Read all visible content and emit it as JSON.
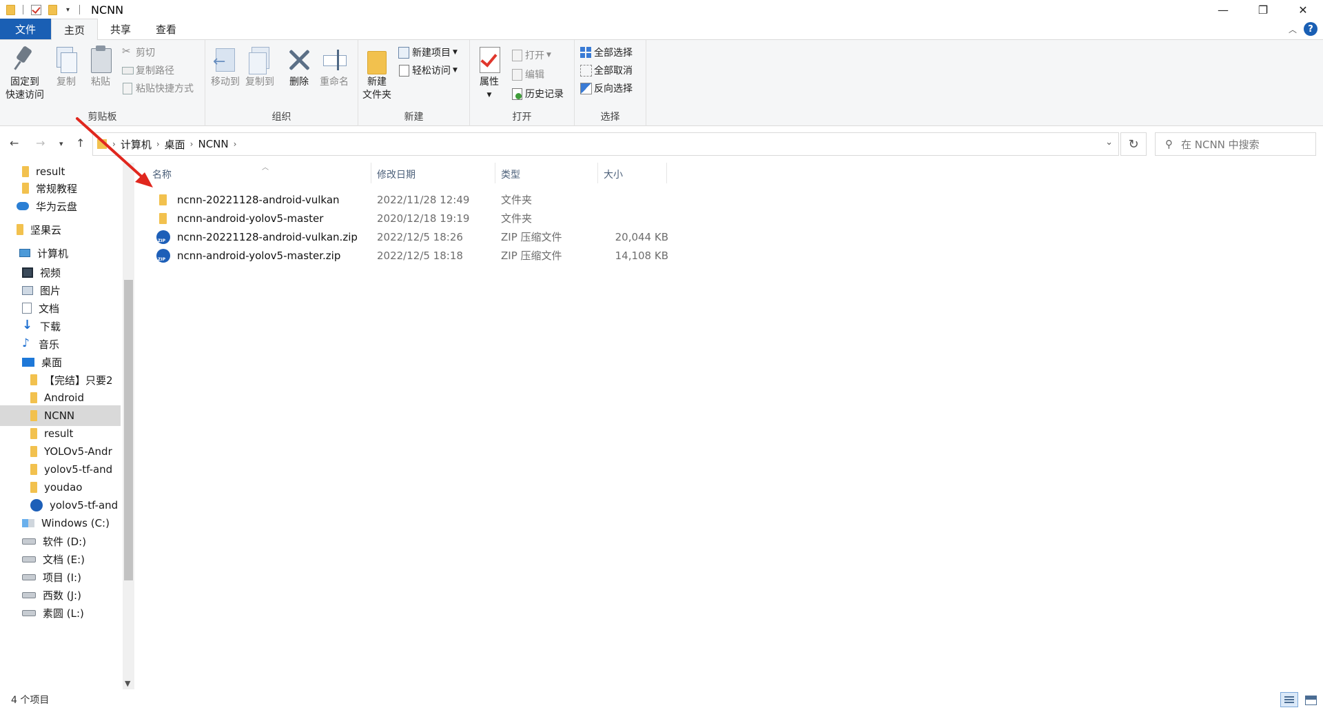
{
  "window": {
    "title": "NCNN",
    "controls": {
      "minimize": "—",
      "maximize": "❐",
      "close": "✕"
    }
  },
  "ribbon_tabs": {
    "file": "文件",
    "home": "主页",
    "share": "共享",
    "view": "查看",
    "help": "?"
  },
  "ribbon": {
    "clipboard": {
      "label": "剪贴板",
      "pin": "固定到\n快速访问",
      "pin_l1": "固定到",
      "pin_l2": "快速访问",
      "copy": "复制",
      "paste": "粘贴",
      "cut": "剪切",
      "copy_path": "复制路径",
      "paste_shortcut": "粘贴快捷方式"
    },
    "organize": {
      "label": "组织",
      "move_to": "移动到",
      "copy_to": "复制到",
      "delete": "删除",
      "rename": "重命名"
    },
    "new": {
      "label": "新建",
      "new_folder_l1": "新建",
      "new_folder_l2": "文件夹",
      "new_item": "新建项目",
      "easy_access": "轻松访问"
    },
    "open": {
      "label": "打开",
      "properties": "属性",
      "open": "打开",
      "edit": "编辑",
      "history": "历史记录"
    },
    "select": {
      "label": "选择",
      "select_all": "全部选择",
      "select_none": "全部取消",
      "invert": "反向选择"
    }
  },
  "address": {
    "crumbs": [
      "计算机",
      "桌面",
      "NCNN"
    ],
    "search_placeholder": "在 NCNN 中搜索"
  },
  "sidebar": {
    "items": [
      {
        "label": "result",
        "icon": "folder-icon",
        "indent": 1
      },
      {
        "label": "常规教程",
        "icon": "folder-icon",
        "indent": 1
      },
      {
        "label": "华为云盘",
        "icon": "cloud-icon",
        "indent": 0
      },
      {
        "label": "坚果云",
        "icon": "folder-icon",
        "indent": 0
      },
      {
        "label": "计算机",
        "icon": "computer-icon",
        "indent": 0
      },
      {
        "label": "视频",
        "icon": "video-icon",
        "indent": 1
      },
      {
        "label": "图片",
        "icon": "picture-icon",
        "indent": 1
      },
      {
        "label": "文档",
        "icon": "document-icon",
        "indent": 1
      },
      {
        "label": "下载",
        "icon": "download-icon",
        "indent": 1
      },
      {
        "label": "音乐",
        "icon": "music-icon",
        "indent": 1
      },
      {
        "label": "桌面",
        "icon": "desktop-icon",
        "indent": 1
      },
      {
        "label": "【完结】只要2",
        "icon": "folder-icon",
        "indent": 2
      },
      {
        "label": "Android",
        "icon": "folder-icon",
        "indent": 2
      },
      {
        "label": "NCNN",
        "icon": "folder-icon",
        "indent": 2,
        "selected": true
      },
      {
        "label": "result",
        "icon": "folder-icon",
        "indent": 2
      },
      {
        "label": "YOLOv5-Andr",
        "icon": "folder-icon",
        "indent": 2
      },
      {
        "label": "yolov5-tf-and",
        "icon": "folder-icon",
        "indent": 2
      },
      {
        "label": "youdao",
        "icon": "folder-icon",
        "indent": 2
      },
      {
        "label": "yolov5-tf-and",
        "icon": "zip-icon",
        "indent": 2
      },
      {
        "label": "Windows (C:)",
        "icon": "windows-drive-icon",
        "indent": 1
      },
      {
        "label": "软件 (D:)",
        "icon": "drive-icon",
        "indent": 1
      },
      {
        "label": "文档 (E:)",
        "icon": "drive-icon",
        "indent": 1
      },
      {
        "label": "项目 (I:)",
        "icon": "drive-icon",
        "indent": 1
      },
      {
        "label": "西数 (J:)",
        "icon": "drive-icon",
        "indent": 1
      },
      {
        "label": "素圆 (L:)",
        "icon": "drive-icon",
        "indent": 1
      }
    ]
  },
  "filelist": {
    "columns": {
      "name": "名称",
      "date": "修改日期",
      "type": "类型",
      "size": "大小"
    },
    "rows": [
      {
        "name": "ncnn-20221128-android-vulkan",
        "date": "2022/11/28 12:49",
        "type": "文件夹",
        "size": "",
        "icon": "folder-icon"
      },
      {
        "name": "ncnn-android-yolov5-master",
        "date": "2020/12/18 19:19",
        "type": "文件夹",
        "size": "",
        "icon": "folder-icon"
      },
      {
        "name": "ncnn-20221128-android-vulkan.zip",
        "date": "2022/12/5 18:26",
        "type": "ZIP 压缩文件",
        "size": "20,044 KB",
        "icon": "zip-icon"
      },
      {
        "name": "ncnn-android-yolov5-master.zip",
        "date": "2022/12/5 18:18",
        "type": "ZIP 压缩文件",
        "size": "14,108 KB",
        "icon": "zip-icon"
      }
    ]
  },
  "status": {
    "item_count": "4 个项目"
  },
  "colors": {
    "accent": "#1a5fb4",
    "folder": "#f2c14e",
    "arrow": "#e0271e",
    "selected": "#d9d9d9"
  }
}
